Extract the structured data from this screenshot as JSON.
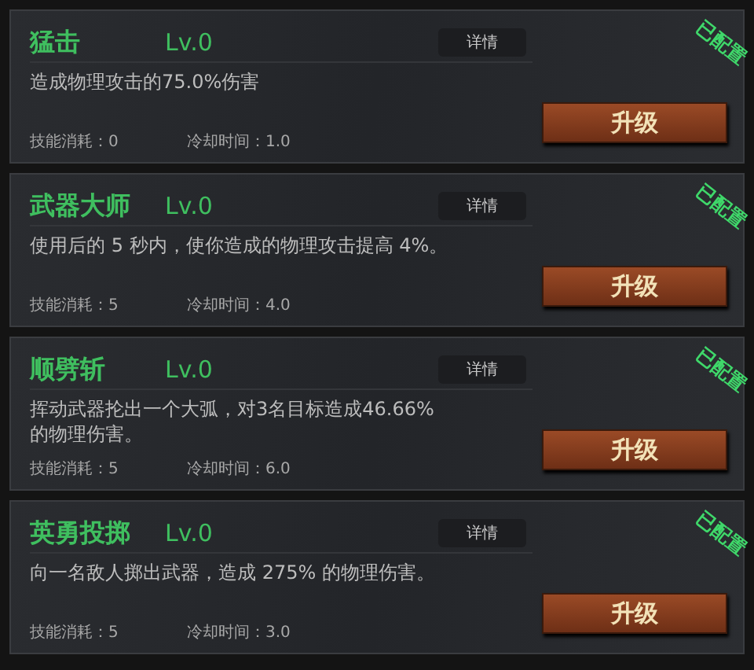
{
  "skills": [
    {
      "name": "猛击",
      "level": "Lv.0",
      "details": "详情",
      "description": "造成物理攻击的75.0%伤害",
      "cost_label": "技能消耗：",
      "cost": "0",
      "cooldown_label": "冷却时间：",
      "cooldown": "1.0",
      "upgrade": "升级",
      "equipped": true,
      "badge": "已配置"
    },
    {
      "name": "武器大师",
      "level": "Lv.0",
      "details": "详情",
      "description": "使用后的 5 秒内，使你造成的物理攻击提高 4%。",
      "cost_label": "技能消耗：",
      "cost": "5",
      "cooldown_label": "冷却时间：",
      "cooldown": "4.0",
      "upgrade": "升级",
      "equipped": true,
      "badge": "已配置"
    },
    {
      "name": "顺劈斩",
      "level": "Lv.0",
      "details": "详情",
      "description": "挥动武器抡出一个大弧，对3名目标造成46.66%的物理伤害。",
      "cost_label": "技能消耗：",
      "cost": "5",
      "cooldown_label": "冷却时间：",
      "cooldown": "6.0",
      "upgrade": "升级",
      "equipped": true,
      "badge": "已配置"
    },
    {
      "name": "英勇投掷",
      "level": "Lv.0",
      "details": "详情",
      "description": "向一名敌人掷出武器，造成 275% 的物理伤害。",
      "cost_label": "技能消耗：",
      "cost": "5",
      "cooldown_label": "冷却时间：",
      "cooldown": "3.0",
      "upgrade": "升级",
      "equipped": true,
      "badge": "已配置"
    }
  ]
}
